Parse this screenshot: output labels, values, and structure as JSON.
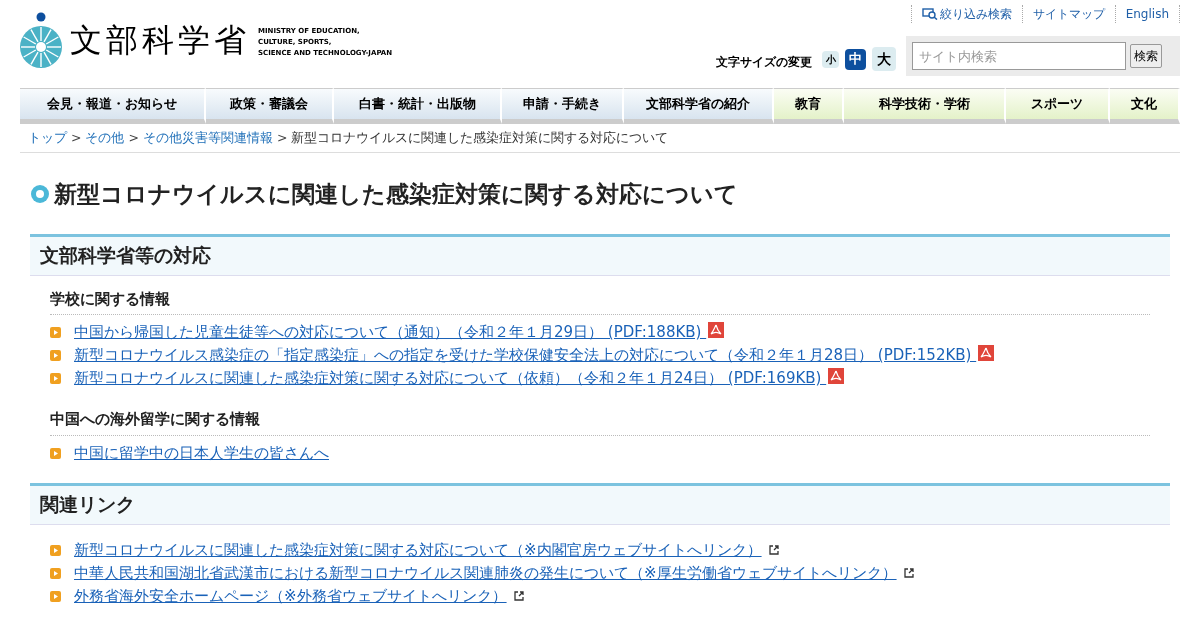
{
  "logo": {
    "name": "文部科学省",
    "english": [
      "MINISTRY OF EDUCATION,",
      "CULTURE, SPORTS,",
      "SCIENCE AND TECHNOLOGY-JAPAN"
    ]
  },
  "utility_links": [
    {
      "label": "絞り込み検索",
      "kind": "search"
    },
    {
      "label": "サイトマップ",
      "kind": "plain"
    },
    {
      "label": "English",
      "kind": "plain"
    }
  ],
  "font_size": {
    "label": "文字サイズの変更",
    "options": [
      {
        "label": "小",
        "selected": false
      },
      {
        "label": "中",
        "selected": true
      },
      {
        "label": "大",
        "selected": false
      }
    ]
  },
  "search": {
    "placeholder": "サイト内検索",
    "button": "検索"
  },
  "nav": [
    {
      "label": "会見・報道・お知らせ",
      "kind": "blue"
    },
    {
      "label": "政策・審議会",
      "kind": "blue"
    },
    {
      "label": "白書・統計・出版物",
      "kind": "blue"
    },
    {
      "label": "申請・手続き",
      "kind": "blue"
    },
    {
      "label": "文部科学省の紹介",
      "kind": "blue"
    },
    {
      "label": "教育",
      "kind": "green"
    },
    {
      "label": "科学技術・学術",
      "kind": "green"
    },
    {
      "label": "スポーツ",
      "kind": "green"
    },
    {
      "label": "文化",
      "kind": "green"
    }
  ],
  "breadcrumb": [
    {
      "label": "トップ",
      "link": true,
      "separator": ">"
    },
    {
      "label": "その他",
      "link": true,
      "separator": ">"
    },
    {
      "label": "その他災害等関連情報",
      "link": true,
      "separator": ">"
    },
    {
      "label": "新型コロナウイルスに関連した感染症対策に関する対応について",
      "link": false
    }
  ],
  "title": "新型コロナウイルスに関連した感染症対策に関する対応について",
  "sections": [
    {
      "heading": "文部科学省等の対応",
      "groups": [
        {
          "subheading": "学校に関する情報",
          "links": [
            {
              "label": "中国から帰国した児童生徒等への対応について（通知）（令和２年１月29日） (PDF:188KB) ",
              "kind": "pdf"
            },
            {
              "label": "新型コロナウイルス感染症の「指定感染症」への指定を受けた学校保健安全法上の対応について（令和２年１月28日） (PDF:152KB) ",
              "kind": "pdf"
            },
            {
              "label": "新型コロナウイルスに関連した感染症対策に関する対応について（依頼）（令和２年１月24日） (PDF:169KB) ",
              "kind": "pdf"
            }
          ]
        },
        {
          "subheading": "中国への海外留学に関する情報",
          "links": [
            {
              "label": "中国に留学中の日本人学生の皆さんへ",
              "kind": "plain"
            }
          ]
        }
      ]
    },
    {
      "heading": "関連リンク",
      "groups": [
        {
          "links": [
            {
              "label": "新型コロナウイルスに関連した感染症対策に関する対応について（※内閣官房ウェブサイトへリンク）",
              "kind": "external"
            },
            {
              "label": "中華人民共和国湖北省武漢市における新型コロナウイルス関連肺炎の発生について（※厚生労働省ウェブサイトへリンク）",
              "kind": "external"
            },
            {
              "label": "外務省海外安全ホームページ（※外務省ウェブサイトへリンク）",
              "kind": "external"
            }
          ]
        }
      ]
    }
  ]
}
